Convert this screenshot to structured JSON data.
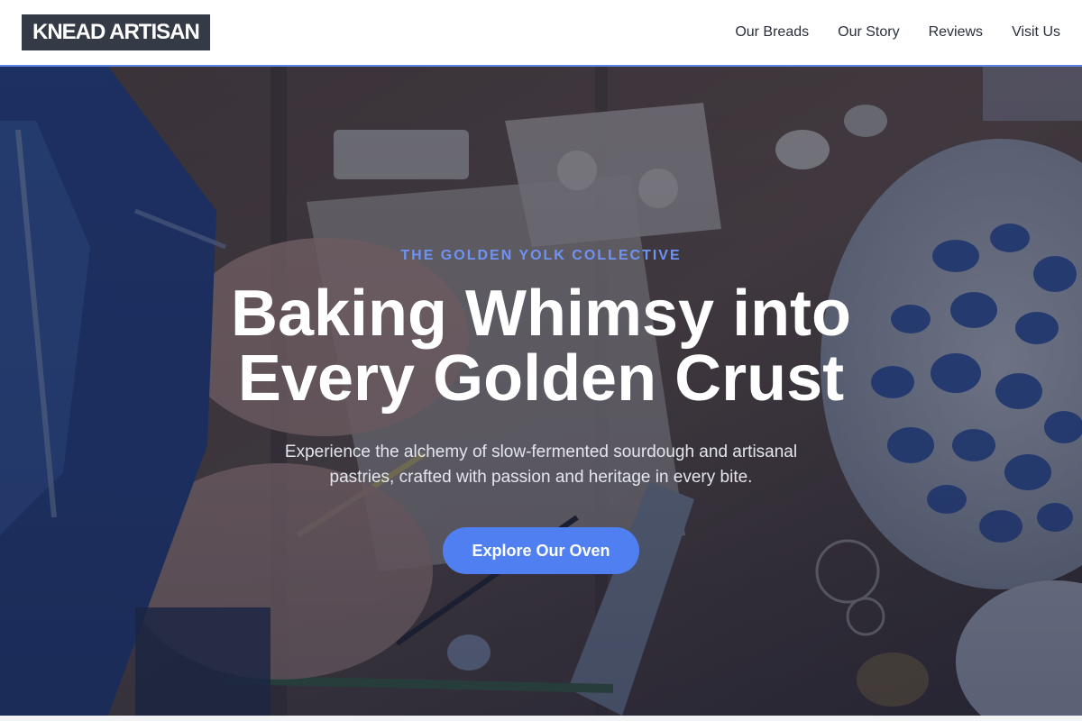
{
  "header": {
    "logo": "KNEAD ARTISAN",
    "nav": [
      {
        "label": "Our Breads"
      },
      {
        "label": "Our Story"
      },
      {
        "label": "Reviews"
      },
      {
        "label": "Visit Us"
      }
    ]
  },
  "hero": {
    "eyebrow": "THE GOLDEN YOLK COLLECTIVE",
    "headline": "Baking Whimsy into Every Golden Crust",
    "subtext": "Experience the alchemy of slow-fermented sourdough and artisanal pastries, crafted with passion and heritage in every bite.",
    "cta_label": "Explore Our Oven"
  },
  "colors": {
    "accent": "#4f7ff0",
    "eyebrow": "#6f93f5",
    "logo_bg": "#343a46",
    "header_border": "#5b86e5"
  },
  "icons": {
    "hero_image": "crafting-workbench-photo"
  }
}
